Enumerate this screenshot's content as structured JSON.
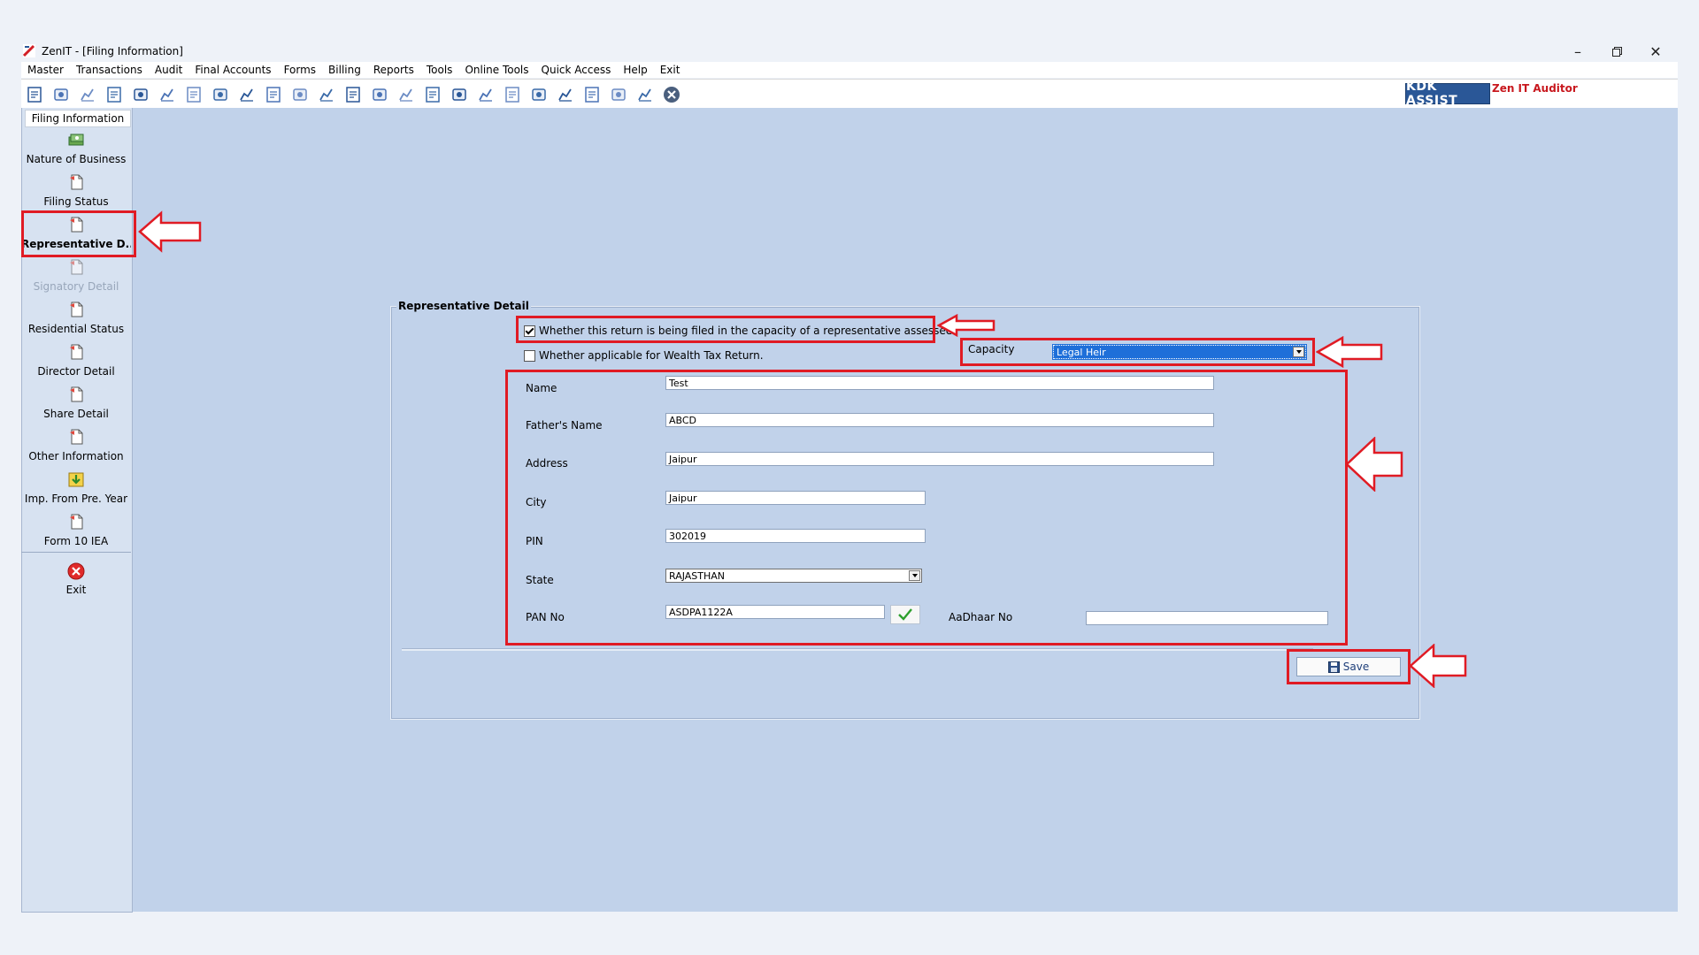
{
  "window": {
    "title": "ZenIT - [Filing Information]",
    "controls": [
      "minimize",
      "restore",
      "close"
    ]
  },
  "menu": [
    "Master",
    "Transactions",
    "Audit",
    "Final Accounts",
    "Forms",
    "Billing",
    "Reports",
    "Tools",
    "Online Tools",
    "Quick Access",
    "Help",
    "Exit"
  ],
  "toolbar": {
    "icons": [
      "open-icon",
      "home-icon",
      "ledger-icon",
      "chart-icon",
      "gift-icon",
      "users-icon",
      "tools-icon",
      "filter-icon",
      "tax-icon",
      "refresh-icon",
      "calculator-icon",
      "pie-chart-icon",
      "pay-icon",
      "book-icon",
      "info-icon",
      "report-icon",
      "document-icon",
      "calendar-icon",
      "export-icon",
      "import-icon",
      "bs-icon",
      "balance-sheet-icon",
      "3cd-icon",
      "form-icon",
      "close-icon"
    ],
    "brand": "KDK ASSIST",
    "brand_tagline": "Zen IT Auditor"
  },
  "sidebar": {
    "header": "Filing Information",
    "items": [
      {
        "label": "Nature of Business",
        "icon": "money-icon",
        "state": "normal"
      },
      {
        "label": "Filing Status",
        "icon": "document-icon",
        "state": "normal"
      },
      {
        "label": "Representative D...",
        "icon": "document-icon",
        "state": "active"
      },
      {
        "label": "Signatory Detail",
        "icon": "document-icon",
        "state": "disabled"
      },
      {
        "label": "Residential Status",
        "icon": "document-icon",
        "state": "normal"
      },
      {
        "label": "Director Detail",
        "icon": "document-icon",
        "state": "normal"
      },
      {
        "label": "Share Detail",
        "icon": "document-icon",
        "state": "normal"
      },
      {
        "label": "Other Information",
        "icon": "document-icon",
        "state": "normal"
      },
      {
        "label": "Imp. From Pre. Year",
        "icon": "import-icon",
        "state": "normal"
      },
      {
        "label": "Form 10 IEA",
        "icon": "document-icon",
        "state": "normal"
      }
    ],
    "exit_label": "Exit"
  },
  "form": {
    "group_title": "Representative Detail",
    "representative_checkbox": {
      "label": "Whether this return is being filed in the capacity of a representative assessee?",
      "checked": true
    },
    "wealth_tax_checkbox": {
      "label": "Whether applicable for Wealth Tax Return.",
      "checked": false
    },
    "capacity": {
      "label": "Capacity",
      "value": "Legal Heir"
    },
    "fields": {
      "name": {
        "label": "Name",
        "value": "Test"
      },
      "father_name": {
        "label": "Father's Name",
        "value": "ABCD"
      },
      "address": {
        "label": "Address",
        "value": "Jaipur"
      },
      "city": {
        "label": "City",
        "value": "Jaipur"
      },
      "pin": {
        "label": "PIN",
        "value": "302019"
      },
      "state": {
        "label": "State",
        "value": "RAJASTHAN"
      },
      "pan": {
        "label": "PAN No",
        "value": "ASDPA1122A"
      },
      "aadhaar": {
        "label": "AaDhaar No",
        "value": ""
      }
    },
    "save_label": "Save"
  },
  "colors": {
    "highlight": "#e01b24",
    "workspace": "#c1d2ea",
    "selection": "#1e6fd9",
    "brand": "#2a5797"
  }
}
